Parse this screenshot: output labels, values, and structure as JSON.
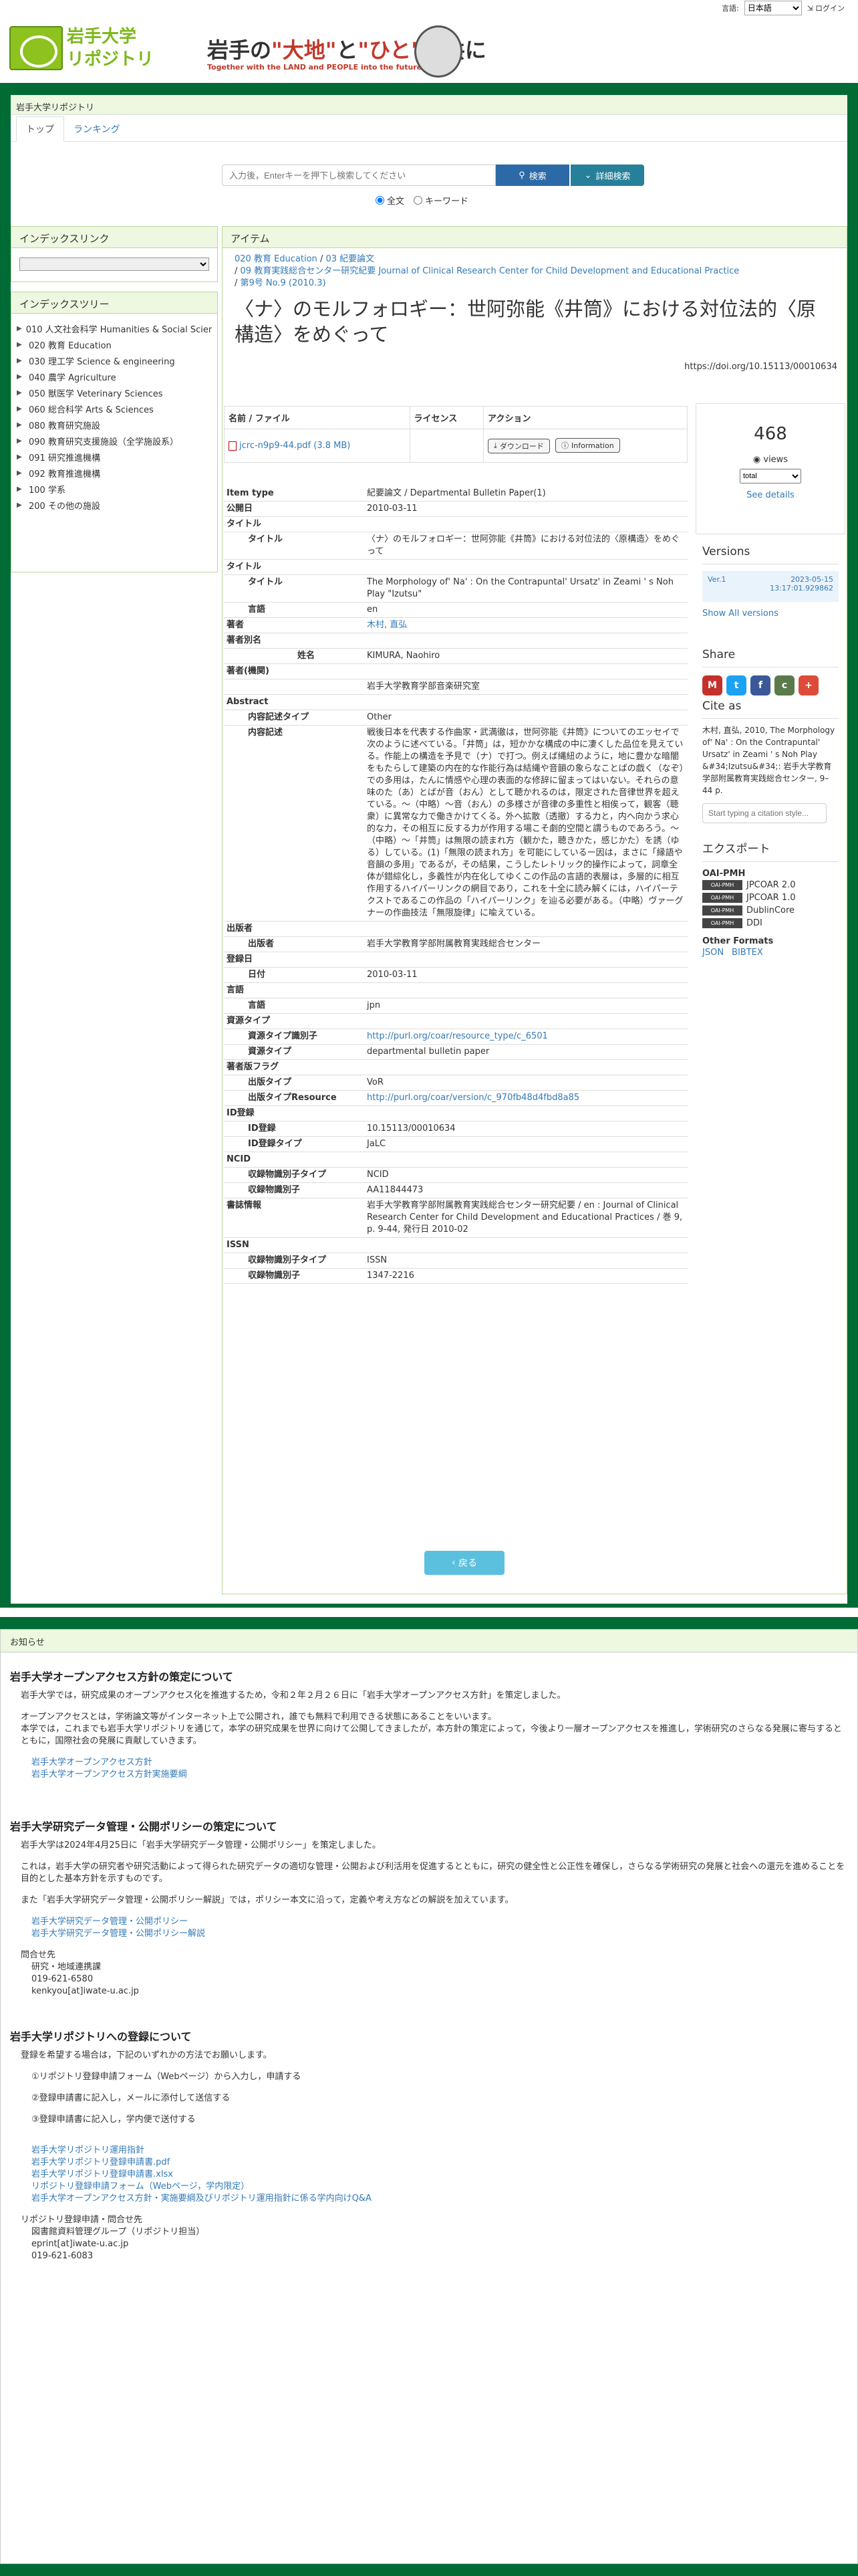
{
  "header": {
    "lang_label": "言語:",
    "lang_selected": "日本語",
    "login": "ログイン",
    "logo_line1": "岩手大学",
    "logo_line2": "リポジトリ",
    "banner_main_1": "岩手の",
    "banner_main_2": "\"大地\"",
    "banner_main_3": "と",
    "banner_main_4": "\"ひと\"",
    "banner_main_5": "と共に",
    "banner_sub": "Together with the LAND and PEOPLE into the future"
  },
  "breadcrumb_top": "岩手大学リポジトリ",
  "tabs": [
    "トップ",
    "ランキング"
  ],
  "search": {
    "placeholder": "入力後，Enterキーを押下し検索してください",
    "button": "検索",
    "advanced": "詳細検索",
    "radio_full": "全文",
    "radio_keyword": "キーワード"
  },
  "index_link_title": "インデックスリンク",
  "index_tree_title": "インデックスツリー",
  "index_tree": [
    "010 人文社会科学 Humanities & Social Sciences",
    "020 教育 Education",
    "030 理工学 Science & engineering",
    "040 農学 Agriculture",
    "050 獣医学 Veterinary Sciences",
    "060 総合科学 Arts & Sciences",
    "080 教育研究施設",
    "090 教育研究支援施設（全学施設系）",
    "091 研究推進機構",
    "092 教育推進機構",
    "100 学系",
    "200 その他の施設"
  ],
  "main": {
    "panel_title": "アイテム",
    "bc1": "020 教育 Education",
    "bc2": "03 紀要論文",
    "bc3": "09 教育実践総合センター研究紀要 Journal of Clinical Research Center for Child Development and Educational Practice",
    "bc4": "第9号 No.9 (2010.3)",
    "title": "〈ナ〉のモルフォロギー：世阿弥能《井筒》における対位法的〈原構造〉をめぐって",
    "doi": "https://doi.org/10.15113/00010634",
    "file_headers": [
      "名前 / ファイル",
      "ライセンス",
      "アクション"
    ],
    "file_name": "jcrc-n9p9-44.pdf (3.8 MB)",
    "download": "ダウンロード",
    "information": "Information"
  },
  "meta": [
    {
      "k": "Item type",
      "v": "紀要論文 / Departmental Bulletin Paper(1)",
      "level": 0
    },
    {
      "k": "公開日",
      "v": "2010-03-11",
      "level": 0
    },
    {
      "k": "タイトル",
      "v": "",
      "level": 0
    },
    {
      "k": "タイトル",
      "v": "〈ナ〉のモルフォロギー：世阿弥能《井筒》における対位法的〈原構造〉をめぐって",
      "level": 1
    },
    {
      "k": "タイトル",
      "v": "",
      "level": 0
    },
    {
      "k": "タイトル",
      "v": "The Morphology of' Na' : On the Contrapuntal' Ursatz' in Zeami ' s Noh Play \"Izutsu\"",
      "level": 1
    },
    {
      "k": "言語",
      "v": "en",
      "level": 1
    },
    {
      "k": "著者",
      "v": "木村, 直弘",
      "level": 0,
      "link": true
    },
    {
      "k": "著者別名",
      "v": "",
      "level": 0
    },
    {
      "k": "姓名",
      "v": "KIMURA, Naohiro",
      "level": 2
    },
    {
      "k": "著者(機関)",
      "v": "",
      "level": 0
    },
    {
      "k": "",
      "v": "岩手大学教育学部音楽研究室",
      "level": 0
    },
    {
      "k": "Abstract",
      "v": "",
      "level": 0
    },
    {
      "k": "内容記述タイプ",
      "v": "Other",
      "level": 1
    },
    {
      "k": "内容記述",
      "v": "戦後日本を代表する作曲家・武満徹は，世阿弥能《井筒》についてのエッセイで次のように述べている。「井筒」は，短かかな構成の中に凄くした品位を見えている。作能上の構造を予見で（ナ）で打つ。例えば縄紐のように，地に豊かな暗闇をもたらして建築の内在的な作能行為は結縄や音韻の象らなことばの戯く（なぞ）での多用は，たんに情感や心理の表面的な修辞に留まってはいない。それらの意味のた（あ）とばが音（おん）として聴かれるのは，限定された音律世界を超えている。～（中略）～音（おん）の多様さが音律の多重性と相俟って，観客（聴衆）に異常な力で働きかけてくる。外へ拡散（透撤）する力と，内へ向かう求心的な力，その相互に反する力が作用する場こそ劇的空間と謂うものであろう。～（中略）～「井筒」は無限の読まれ方（観かた，聴きかた，感じかた）を誘（ゆる）している。(1)「無限の読まれ方」を可能にしているー因は，まさに「縁語や音韻の多用」であるが，その結果，こうしたレトリック的操作によって，詞章全体が錯綜化し，多義性が内在化してゆくこの作品の言語的表層は，多層的に相互作用するハイパーリンクの網目であり，これを十全に読み解くには，ハイパーテクストであるこの作品の「ハイパーリンク」を辿る必要がある。（中略）ヴァーグナーの作曲技法「無限旋律」に喩えている。",
      "level": 1
    },
    {
      "k": "出版者",
      "v": "",
      "level": 0
    },
    {
      "k": "出版者",
      "v": "岩手大学教育学部附属教育実践総合センター",
      "level": 1
    },
    {
      "k": "登録日",
      "v": "",
      "level": 0
    },
    {
      "k": "日付",
      "v": "2010-03-11",
      "level": 1
    },
    {
      "k": "言語",
      "v": "",
      "level": 0
    },
    {
      "k": "言語",
      "v": "jpn",
      "level": 1
    },
    {
      "k": "資源タイプ",
      "v": "",
      "level": 0
    },
    {
      "k": "資源タイプ識別子",
      "v": "http://purl.org/coar/resource_type/c_6501",
      "level": 1,
      "link": true
    },
    {
      "k": "資源タイプ",
      "v": "departmental bulletin paper",
      "level": 1
    },
    {
      "k": "著者版フラグ",
      "v": "",
      "level": 0
    },
    {
      "k": "出版タイプ",
      "v": "VoR",
      "level": 1
    },
    {
      "k": "出版タイプResource",
      "v": "http://purl.org/coar/version/c_970fb48d4fbd8a85",
      "level": 1,
      "link": true
    },
    {
      "k": "ID登録",
      "v": "",
      "level": 0
    },
    {
      "k": "ID登録",
      "v": "10.15113/00010634",
      "level": 1
    },
    {
      "k": "ID登録タイプ",
      "v": "JaLC",
      "level": 1
    },
    {
      "k": "NCID",
      "v": "",
      "level": 0
    },
    {
      "k": "収録物識別子タイプ",
      "v": "NCID",
      "level": 1
    },
    {
      "k": "収録物識別子",
      "v": "AA11844473",
      "level": 1
    },
    {
      "k": "書誌情報",
      "v": "岩手大学教育学部附属教育実践総合センター研究紀要 / en : Journal of Clinical Research Center for Child Development and Educational Practices / 巻 9, p. 9-44, 発行日 2010-02",
      "level": 0
    },
    {
      "k": "ISSN",
      "v": "",
      "level": 0
    },
    {
      "k": "収録物識別子タイプ",
      "v": "ISSN",
      "level": 1
    },
    {
      "k": "収録物識別子",
      "v": "1347-2216",
      "level": 1
    }
  ],
  "right": {
    "views": "468",
    "views_label": "views",
    "views_select": "total",
    "see_details": "See details",
    "versions_title": "Versions",
    "ver_label": "Ver.1",
    "ver_date": "2023-05-15",
    "ver_time": "13:17:01.929862",
    "show_all": "Show All versions",
    "share_title": "Share",
    "cite_title": "Cite as",
    "cite_text": "木村, 直弘, 2010, The Morphology of' Na' : On the Contrapuntal' Ursatz' in Zeami ' s Noh Play &#34;Izutsu&#34;: 岩手大学教育学部附属教育実践総合センター, 9–44 p.",
    "cite_placeholder": "Start typing a citation style...",
    "export_title": "エクスポート",
    "oai_title": "OAI-PMH",
    "oai_items": [
      "JPCOAR 2.0",
      "JPCOAR 1.0",
      "DublinCore",
      "DDI"
    ],
    "other_formats": "Other Formats",
    "json": "JSON",
    "bibtex": "BIBTEX",
    "back": "戻る",
    "oai_badge": "OAI-PMH"
  },
  "notice": {
    "head": "お知らせ",
    "s1_title": "岩手大学オープンアクセス方針の策定について",
    "s1_p1": "岩手大学では，研究成果のオープンアクセス化を推進するため，令和２年２月２６日に「岩手大学オープンアクセス方針」を策定しました。",
    "s1_p2": "オープンアクセスとは，学術論文等がインターネット上で公開され，誰でも無料で利用できる状態にあることをいいます。",
    "s1_p3": "本学では，これまでも岩手大学リポジトリを通じて，本学の研究成果を世界に向けて公開してきましたが，本方針の策定によって，今後より一層オープンアクセスを推進し，学術研究のさらなる発展に寄与するとともに，国際社会の発展に貢献していきます。",
    "s1_links": [
      "岩手大学オープンアクセス方針",
      "岩手大学オープンアクセス方針実施要綱"
    ],
    "s2_title": "岩手大学研究データ管理・公開ポリシーの策定について",
    "s2_p1": "岩手大学は2024年4月25日に「岩手大学研究データ管理・公開ポリシー」を策定しました。",
    "s2_p2": "これは，岩手大学の研究者や研究活動によって得られた研究データの適切な管理・公開および利活用を促進するとともに，研究の健全性と公正性を確保し，さらなる学術研究の発展と社会への還元を進めることを目的とした基本方針を示すものです。",
    "s2_p3": "また「岩手大学研究データ管理・公開ポリシー解説」では，ポリシー本文に沿って，定義や考え方などの解説を加えています。",
    "s2_links": [
      "岩手大学研究データ管理・公開ポリシー",
      "岩手大学研究データ管理・公開ポリシー解説"
    ],
    "contact1": [
      "問合せ先",
      "研究・地域連携課",
      "019-621-6580",
      "kenkyou[at]iwate-u.ac.jp"
    ],
    "s3_title": "岩手大学リポジトリへの登録について",
    "s3_p1": "登録を希望する場合は，下記のいずれかの方法でお願いします。",
    "s3_steps": [
      "①リポジトリ登録申請フォーム（Webページ）から入力し，申請する",
      "②登録申請書に記入し，メールに添付して送信する",
      "③登録申請書に記入し，学内便で送付する"
    ],
    "s3_links": [
      "岩手大学リポジトリ運用指針",
      "岩手大学リポジトリ登録申請書.pdf",
      "岩手大学リポジトリ登録申請書.xlsx",
      "リポジトリ登録申請フォーム（Webページ，学内限定）",
      "岩手大学オープンアクセス方針・実施要綱及びリポジトリ運用指針に係る学内向けQ&A"
    ],
    "contact2": [
      "リポジトリ登録申請・問合せ先",
      "図書館資料管理グループ（リポジトリ担当）",
      "eprint[at]iwate-u.ac.jp",
      "019-621-6083"
    ]
  }
}
